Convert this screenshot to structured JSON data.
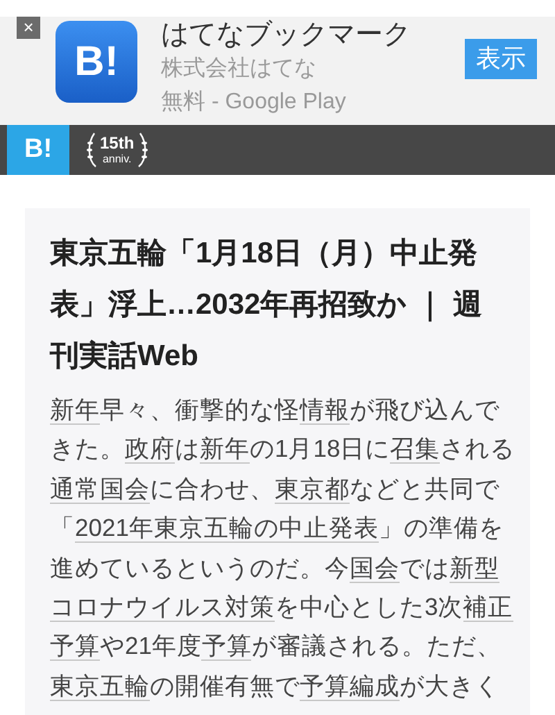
{
  "app_banner": {
    "close": "×",
    "icon_text": "B!",
    "name": "はてなブックマーク",
    "publisher": "株式会社はてな",
    "price": "無料 - Google Play",
    "button": "表示"
  },
  "site_bar": {
    "logo": "B!",
    "badge_top": "15th",
    "badge_bottom": "anniv."
  },
  "article": {
    "title": "東京五輪「1月18日（月）中止発表」浮上…2032年再招致か ｜ 週刊実話Web",
    "body_lines": [
      [
        {
          "text": "新年",
          "link": true
        },
        {
          "text": "早々、衝撃的な怪",
          "link": false
        },
        {
          "text": "情報",
          "link": true
        },
        {
          "text": "が飛び込んで",
          "link": false
        }
      ],
      [
        {
          "text": "きた。",
          "link": false
        },
        {
          "text": "政府",
          "link": true
        },
        {
          "text": "は",
          "link": false
        },
        {
          "text": "新年",
          "link": true
        },
        {
          "text": "の1月18日に",
          "link": false
        },
        {
          "text": "召集",
          "link": true
        },
        {
          "text": "される",
          "link": false
        }
      ],
      [
        {
          "text": "通常国会",
          "link": true
        },
        {
          "text": "に合わせ、",
          "link": false
        },
        {
          "text": "東京都",
          "link": true
        },
        {
          "text": "などと共同で",
          "link": false
        }
      ],
      [
        {
          "text": "「",
          "link": false
        },
        {
          "text": "2021年東京五輪の中止発表",
          "link": true
        },
        {
          "text": "」の準備を",
          "link": false
        }
      ],
      [
        {
          "text": "進めているというのだ。今",
          "link": false
        },
        {
          "text": "国会",
          "link": true
        },
        {
          "text": "では",
          "link": false
        },
        {
          "text": "新型",
          "link": true
        }
      ],
      [
        {
          "text": "コロナウイルス対策",
          "link": true
        },
        {
          "text": "を中心とした3次",
          "link": false
        },
        {
          "text": "補正",
          "link": true
        }
      ],
      [
        {
          "text": "予算",
          "link": true
        },
        {
          "text": "や21年度",
          "link": false
        },
        {
          "text": "予算",
          "link": true
        },
        {
          "text": "が審議される。ただ、",
          "link": false
        }
      ],
      [
        {
          "text": "東京五輪",
          "link": true
        },
        {
          "text": "の開催有無で",
          "link": false
        },
        {
          "text": "予算編成",
          "link": true
        },
        {
          "text": "が大きく",
          "link": false
        }
      ]
    ]
  }
}
